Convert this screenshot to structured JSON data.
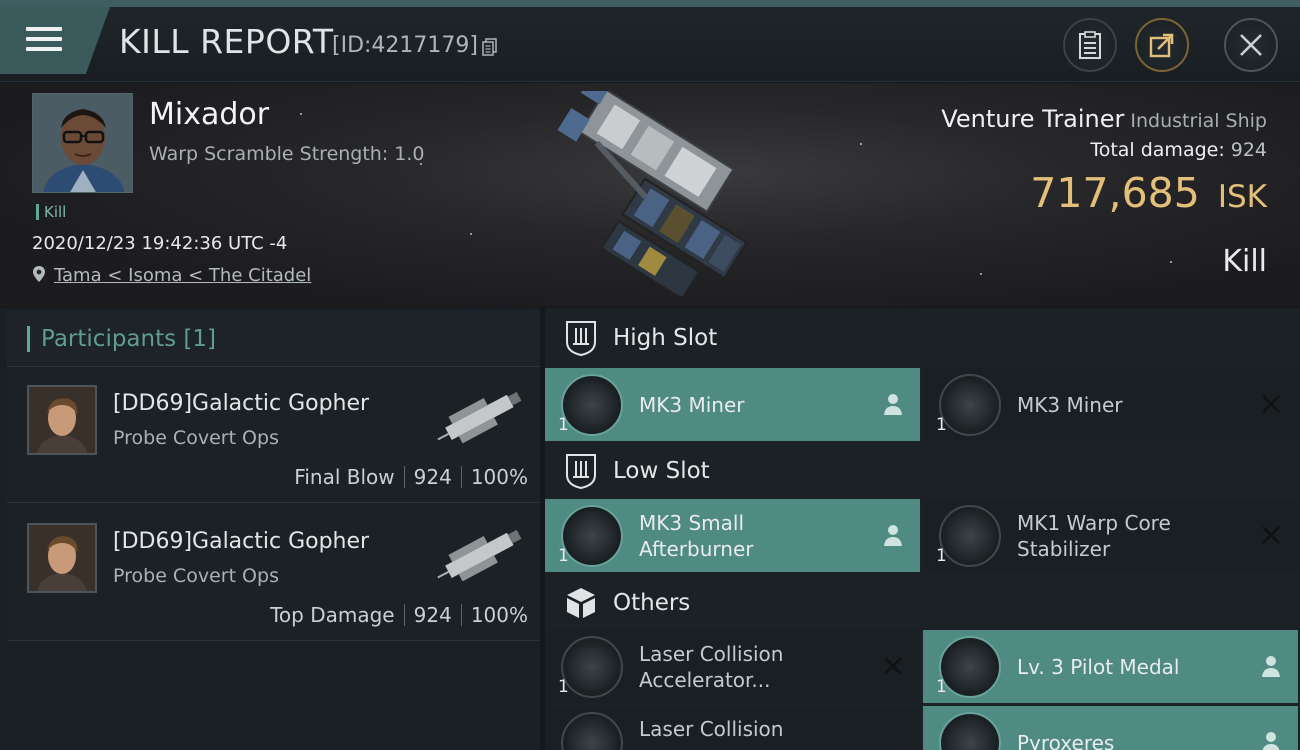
{
  "header": {
    "title": "KILL REPORT",
    "kill_id": "[ID:4217179]"
  },
  "victim": {
    "name": "Mixador",
    "warp_scramble": "Warp Scramble Strength: 1.0",
    "tag": "Kill",
    "timestamp": "2020/12/23 19:42:36 UTC -4",
    "location": "Tama < Isoma < The Citadel"
  },
  "ship": {
    "name": "Venture Trainer",
    "class": "Industrial Ship",
    "total_damage_label": "Total damage:",
    "total_damage": "924",
    "isk_value": "717,685",
    "isk_unit": "ISK",
    "result": "Kill"
  },
  "participants": {
    "label": "Participants [1]",
    "rows": [
      {
        "name": "[DD69]Galactic Gopher",
        "ship": "Probe Covert Ops",
        "role": "Final Blow",
        "damage": "924",
        "percent": "100%"
      },
      {
        "name": "[DD69]Galactic Gopher",
        "ship": "Probe Covert Ops",
        "role": "Top Damage",
        "damage": "924",
        "percent": "100%"
      }
    ]
  },
  "slots": {
    "high": {
      "label": "High Slot",
      "modules": [
        {
          "name": "MK3 Miner",
          "qty": "1",
          "status": "fitted"
        },
        {
          "name": "MK3 Miner",
          "qty": "1",
          "status": "destroyed"
        }
      ]
    },
    "low": {
      "label": "Low Slot",
      "modules": [
        {
          "line1": "MK3 Small",
          "line2": "Afterburner",
          "qty": "1",
          "status": "fitted"
        },
        {
          "line1": "MK1 Warp Core",
          "line2": "Stabilizer",
          "qty": "1",
          "status": "destroyed"
        }
      ]
    },
    "others": {
      "label": "Others",
      "modules": [
        {
          "line1": "Laser Collision",
          "line2": "Accelerator...",
          "qty": "1",
          "status": "destroyed"
        },
        {
          "name": "Lv. 3 Pilot Medal",
          "qty": "1",
          "status": "fitted"
        },
        {
          "line1": "Laser Collision",
          "qty": "",
          "status": "destroyed"
        },
        {
          "name": "Pyroxeres",
          "qty": "",
          "status": "fitted"
        }
      ]
    }
  },
  "colors": {
    "accent_teal": "#4f8a83",
    "isk_gold": "#e3c07a",
    "tag_green": "#7fb8ad"
  },
  "icons": [
    "menu-icon",
    "copy-icon",
    "clipboard-icon",
    "share-icon",
    "close-icon",
    "location-pin-icon",
    "high-slot-icon",
    "low-slot-icon",
    "cube-icon",
    "pilot-icon",
    "destroyed-x-icon"
  ]
}
